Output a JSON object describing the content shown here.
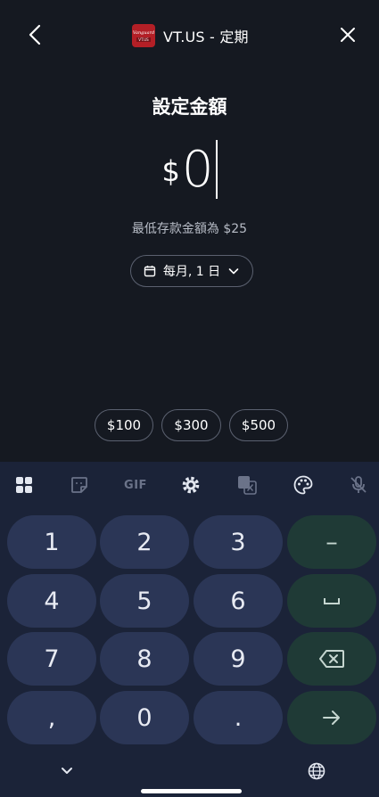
{
  "header": {
    "title": "VT.US - 定期",
    "logo": {
      "line1": "Vanguard",
      "line2": "VT.US"
    }
  },
  "heading": "設定金額",
  "amount": {
    "currency": "$",
    "value": "0"
  },
  "min_note": "最低存款金額為 $25",
  "schedule": {
    "label": "每月, 1 日"
  },
  "presets": [
    "$100",
    "$300",
    "$500"
  ],
  "keyboard": {
    "toolbar": {
      "gif_label": "GIF"
    },
    "keys": {
      "k1": "1",
      "k2": "2",
      "k3": "3",
      "minus": "–",
      "k4": "4",
      "k5": "5",
      "k6": "6",
      "k7": "7",
      "k8": "8",
      "k9": "9",
      "comma": ",",
      "k0": "0",
      "period": "."
    }
  },
  "colors": {
    "background": "#151921",
    "keyboard_bg": "#1b2338",
    "key_bg": "#2b3656",
    "action_key_bg": "#1f3a36",
    "logo_red": "#b31f26"
  }
}
